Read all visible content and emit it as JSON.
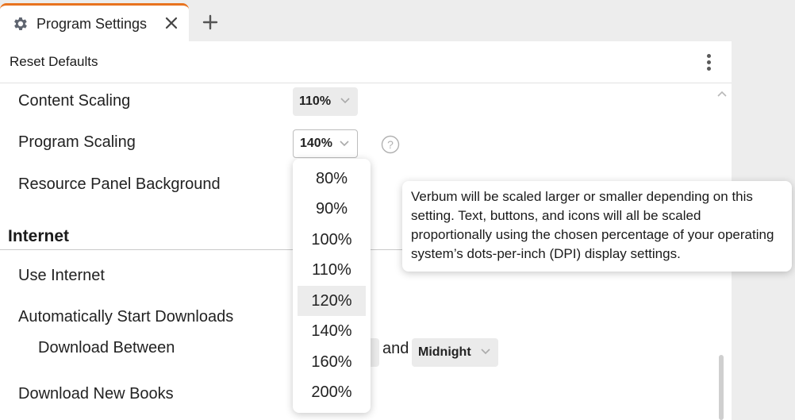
{
  "tab": {
    "title": "Program Settings",
    "icon": "gear-icon",
    "accent": "#e8731f"
  },
  "toolbar": {
    "reset_label": "Reset Defaults"
  },
  "settings": {
    "content_scaling": {
      "label": "Content Scaling",
      "value": "110%"
    },
    "program_scaling": {
      "label": "Program Scaling",
      "value": "140%"
    },
    "resource_panel_background": {
      "label": "Resource Panel Background"
    }
  },
  "internet": {
    "heading": "Internet",
    "use_internet": {
      "label": "Use Internet"
    },
    "auto_start_downloads": {
      "label": "Automatically Start Downloads"
    },
    "download_between": {
      "label": "Download Between",
      "joiner": "and",
      "end_value": "Midnight"
    },
    "download_new_books": {
      "label": "Download New Books"
    }
  },
  "dropdown": {
    "options": [
      "80%",
      "90%",
      "100%",
      "110%",
      "120%",
      "140%",
      "160%",
      "200%"
    ],
    "highlighted": "120%"
  },
  "tooltip": {
    "text": "Verbum will be scaled larger or smaller depending on this setting. Text, buttons, and icons will all be scaled proportionally using the chosen percentage of your operating system’s dots-per-inch (DPI) display settings."
  }
}
